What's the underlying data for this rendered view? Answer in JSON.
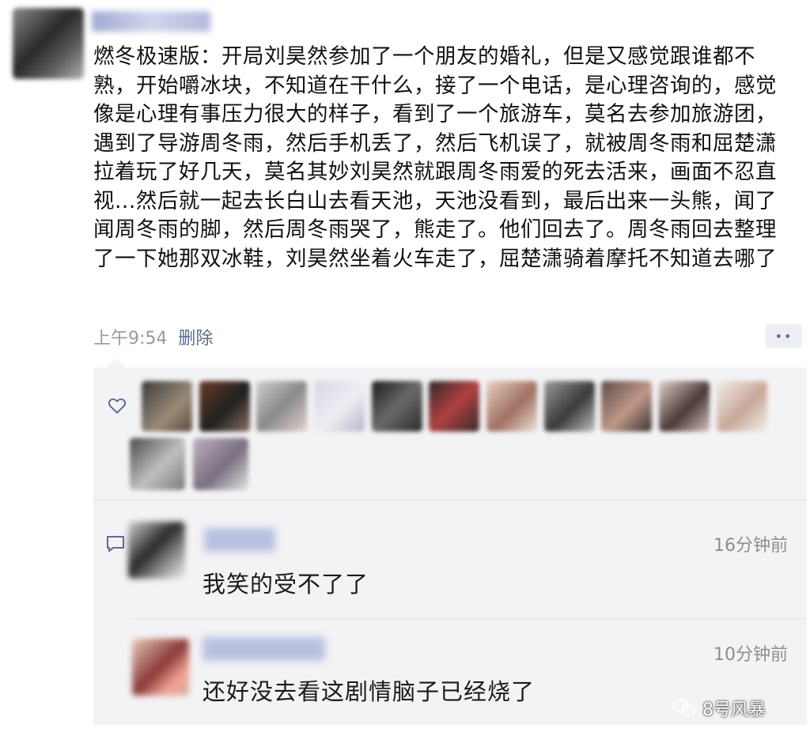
{
  "post": {
    "text": "燃冬极速版：开局刘昊然参加了一个朋友的婚礼，但是又感觉跟谁都不熟，开始嚼冰块，不知道在干什么，接了一个电话，是心理咨询的，感觉像是心理有事压力很大的样子，看到了一个旅游车，莫名去参加旅游团，遇到了导游周冬雨，然后手机丢了，然后飞机误了，就被周冬雨和屈楚潇拉着玩了好几天，莫名其妙刘昊然就跟周冬雨爱的死去活来，画面不忍直视...然后就一起去长白山去看天池，天池没看到，最后出来一头熊，闻了闻周冬雨的脚，然后周冬雨哭了，熊走了。他们回去了。周冬雨回去整理了一下她那双冰鞋，刘昊然坐着火车走了，屈楚潇骑着摩托不知道去哪了",
    "time": "上午9:54",
    "delete_label": "删除",
    "more_label": "••"
  },
  "comments": [
    {
      "time": "16分钟前",
      "text": "我笑的受不了了"
    },
    {
      "time": "10分钟前",
      "text": "还好没去看这剧情脑子已经烧了"
    }
  ],
  "watermark": {
    "text": "8号风暴"
  },
  "icons": {
    "heart": "heart-icon",
    "comment": "comment-icon",
    "more": "more-icon",
    "watermark": "wechat-icon"
  },
  "colors": {
    "link": "#5b6b95",
    "panel": "#f3f3f5",
    "meta": "#9a9a9a"
  }
}
